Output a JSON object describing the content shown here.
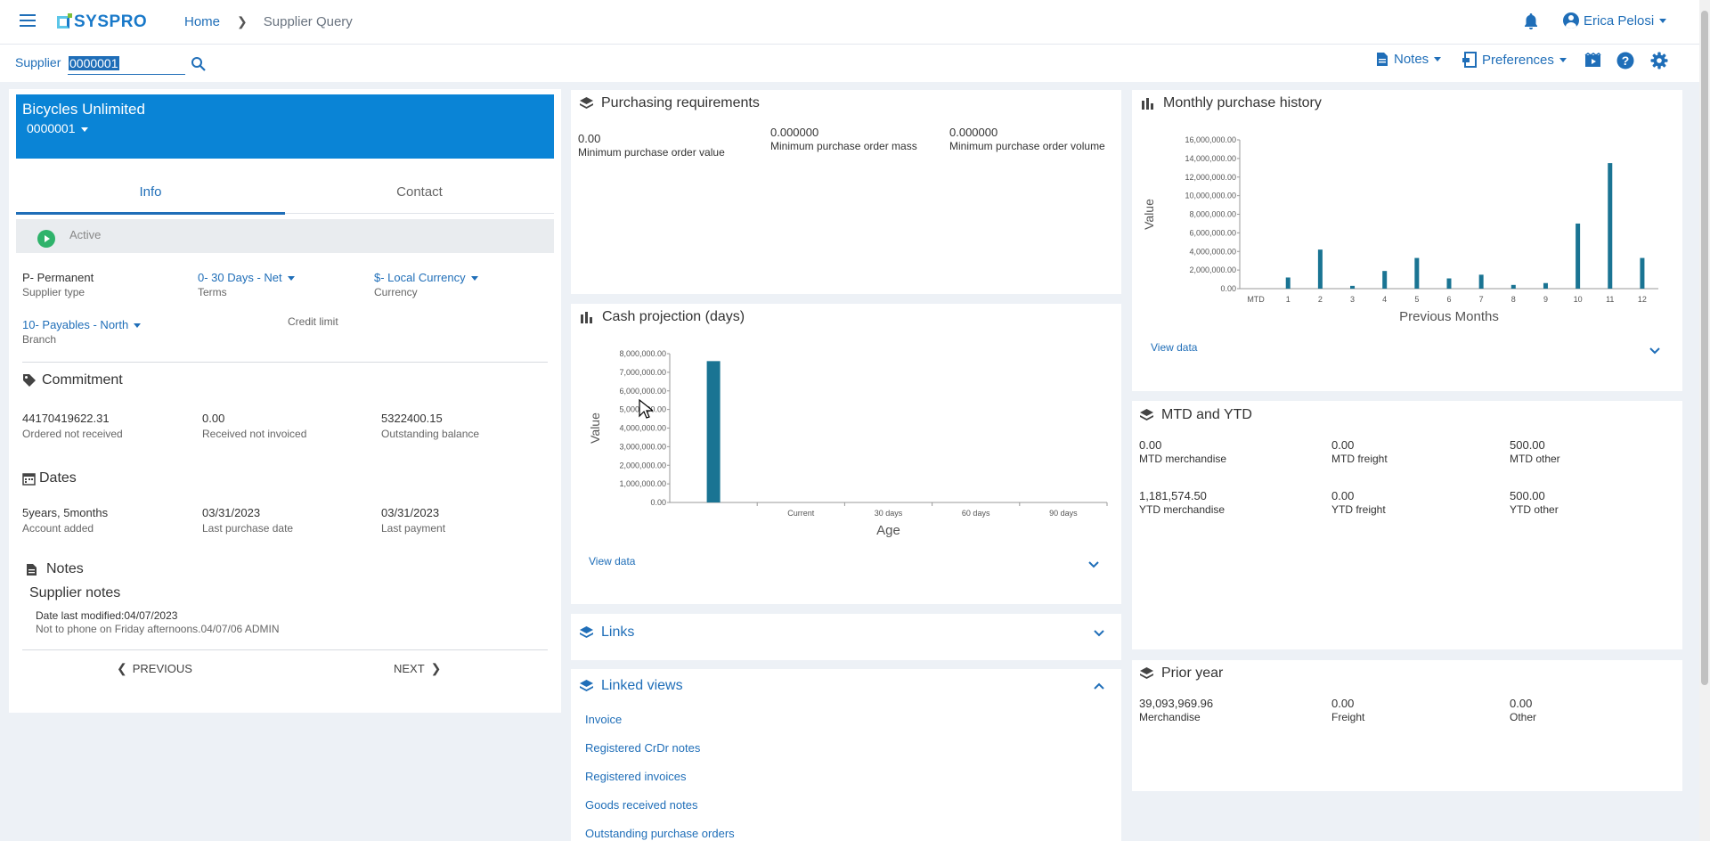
{
  "nav": {
    "brand": "SYSPRO",
    "home": "Home",
    "current": "Supplier Query",
    "user": "Erica Pelosi"
  },
  "toolbar": {
    "supplier_label": "Supplier",
    "supplier_value": "0000001",
    "notes": "Notes",
    "preferences": "Preferences"
  },
  "supplier": {
    "name": "Bicycles Unlimited",
    "code": "0000001",
    "tabs": [
      "Info",
      "Contact"
    ],
    "status": "Active",
    "fields": {
      "supplier_type": {
        "value": "P- Permanent",
        "label": "Supplier type"
      },
      "terms": {
        "value": "0- 30 Days - Net",
        "label": "Terms"
      },
      "currency": {
        "value": "$- Local Currency",
        "label": "Currency"
      },
      "branch": {
        "value": "10- Payables - North",
        "label": "Branch"
      },
      "credit_limit": {
        "label": "Credit limit"
      }
    },
    "commitment": {
      "title": "Commitment",
      "items": [
        {
          "value": "44170419622.31",
          "label": "Ordered not received"
        },
        {
          "value": "0.00",
          "label": "Received not invoiced"
        },
        {
          "value": "5322400.15",
          "label": "Outstanding balance"
        }
      ]
    },
    "dates": {
      "title": "Dates",
      "items": [
        {
          "value": "5years, 5months",
          "label": "Account added"
        },
        {
          "value": "03/31/2023",
          "label": "Last purchase date"
        },
        {
          "value": "03/31/2023",
          "label": "Last payment"
        }
      ]
    },
    "notes": {
      "title": "Notes",
      "subtitle": "Supplier notes",
      "modified": "Date last modified:04/07/2023",
      "text": "Not to phone on Friday afternoons.04/07/06 ADMIN"
    },
    "prev": "PREVIOUS",
    "next": "NEXT"
  },
  "purchasing": {
    "title": "Purchasing requirements",
    "items": [
      {
        "value": "0.00",
        "label": "Minimum purchase order value"
      },
      {
        "value": "0.000000",
        "label": "Minimum purchase order mass"
      },
      {
        "value": "0.000000",
        "label": "Minimum purchase order volume"
      }
    ]
  },
  "cash": {
    "title": "Cash projection (days)",
    "view_data": "View data",
    "chart_data": {
      "type": "bar",
      "categories": [
        "",
        "Current",
        "30 days",
        "60 days",
        "90 days"
      ],
      "values": [
        7600000,
        0,
        0,
        0,
        0
      ],
      "xlabel": "Age",
      "ylabel": "Value",
      "ylim": [
        0,
        8000000
      ],
      "yticks": [
        "0.00",
        "1,000,000.00",
        "2,000,000.00",
        "3,000,000.00",
        "4,000,000.00",
        "5,000,000.00",
        "6,000,000.00",
        "7,000,000.00",
        "8,000,000.00"
      ]
    }
  },
  "monthly": {
    "title": "Monthly purchase history",
    "view_data": "View data",
    "chart_data": {
      "type": "bar",
      "categories": [
        "MTD",
        "1",
        "2",
        "3",
        "4",
        "5",
        "6",
        "7",
        "8",
        "9",
        "10",
        "11",
        "12"
      ],
      "values": [
        0,
        1200000,
        4200000,
        300000,
        1900000,
        3300000,
        1100000,
        1500000,
        400000,
        600000,
        7000000,
        13500000,
        3300000
      ],
      "xlabel": "Previous Months",
      "ylabel": "Value",
      "ylim": [
        0,
        16000000
      ],
      "yticks": [
        "0.00",
        "2,000,000.00",
        "4,000,000.00",
        "6,000,000.00",
        "8,000,000.00",
        "10,000,000.00",
        "12,000,000.00",
        "14,000,000.00",
        "16,000,000.00"
      ]
    }
  },
  "mtd": {
    "title": "MTD and YTD",
    "rows": [
      [
        {
          "value": "0.00",
          "label": "MTD merchandise"
        },
        {
          "value": "0.00",
          "label": "MTD freight"
        },
        {
          "value": "500.00",
          "label": "MTD other"
        }
      ],
      [
        {
          "value": "1,181,574.50",
          "label": "YTD merchandise"
        },
        {
          "value": "0.00",
          "label": "YTD freight"
        },
        {
          "value": "500.00",
          "label": "YTD other"
        }
      ]
    ]
  },
  "prior": {
    "title": "Prior year",
    "items": [
      {
        "value": "39,093,969.96",
        "label": "Merchandise"
      },
      {
        "value": "0.00",
        "label": "Freight"
      },
      {
        "value": "0.00",
        "label": "Other"
      }
    ]
  },
  "links": {
    "title": "Links"
  },
  "linked": {
    "title": "Linked views",
    "items": [
      "Invoice",
      "Registered CrDr notes",
      "Registered invoices",
      "Goods received notes",
      "Outstanding purchase orders"
    ]
  },
  "colors": {
    "primary": "#0a84d6",
    "link": "#1f6eb8",
    "bar": "#1a7493",
    "active": "#2fb36b"
  }
}
